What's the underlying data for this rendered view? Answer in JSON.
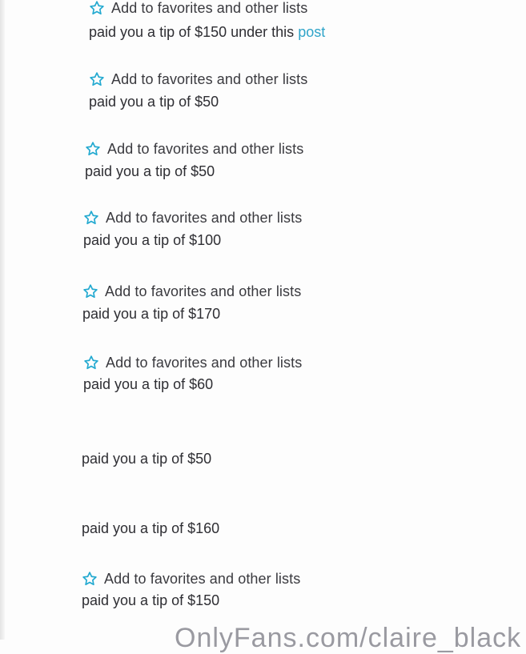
{
  "favorites_label": "Add to favorites and other lists",
  "notifications": [
    {
      "has_fav": true,
      "tip": "paid you a tip of $150 under this",
      "link": "post"
    },
    {
      "has_fav": true,
      "tip": "paid you a tip of $50"
    },
    {
      "has_fav": true,
      "tip": "paid you a tip of $50"
    },
    {
      "has_fav": true,
      "tip": "paid you a tip of $100"
    },
    {
      "has_fav": true,
      "tip": "paid you a tip of $170"
    },
    {
      "has_fav": true,
      "tip": "paid you a tip of $60"
    },
    {
      "has_fav": false,
      "tip": "paid you a tip of $50"
    },
    {
      "has_fav": false,
      "tip": "paid you a tip of $160"
    },
    {
      "has_fav": true,
      "tip": "paid you a tip of $150"
    }
  ],
  "watermark": "OnlyFans.com/claire_black",
  "colors": {
    "accent": "#2fa4c9",
    "star": "#22a9d0",
    "text": "#2e2e33"
  },
  "icons": {
    "favorite": "star-outline-icon"
  }
}
